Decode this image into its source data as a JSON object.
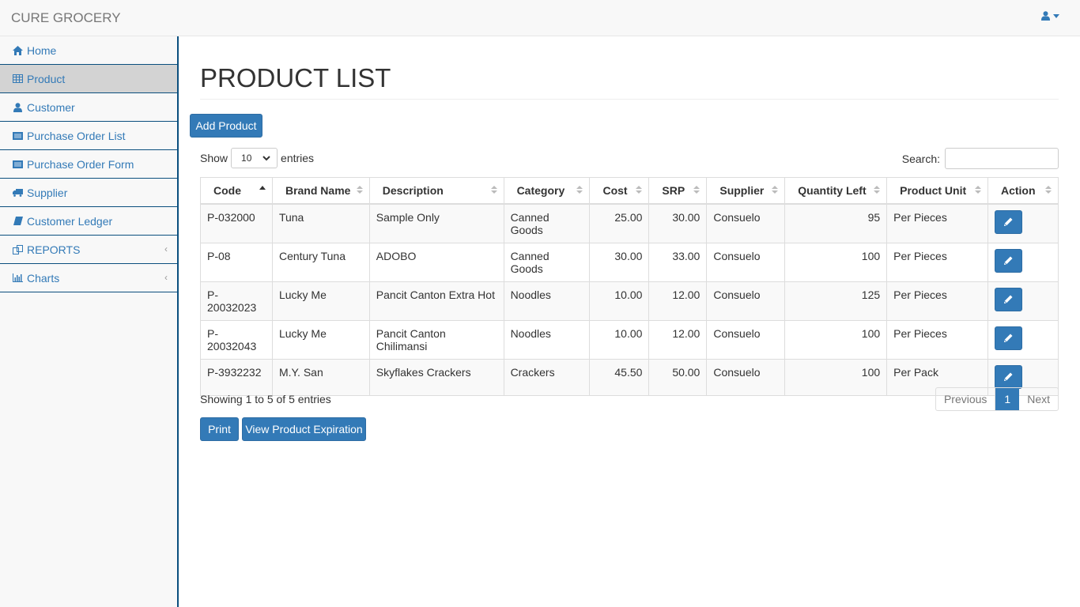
{
  "app": {
    "brand": "CURE GROCERY"
  },
  "colors": {
    "primary": "#337ab7",
    "sidebar_border": "#0b4f7e",
    "active_bg": "#d3d3d3"
  },
  "sidebar": {
    "items": [
      {
        "label": "Home",
        "icon": "home-icon"
      },
      {
        "label": "Product",
        "icon": "table-icon",
        "active": true
      },
      {
        "label": "Customer",
        "icon": "user-icon"
      },
      {
        "label": "Purchase Order List",
        "icon": "list-alt-icon"
      },
      {
        "label": "Purchase Order Form",
        "icon": "list-alt-icon"
      },
      {
        "label": "Supplier",
        "icon": "truck-icon"
      },
      {
        "label": "Customer Ledger",
        "icon": "book-icon"
      },
      {
        "label": "REPORTS",
        "icon": "copy-icon",
        "caret": "‹"
      },
      {
        "label": "Charts",
        "icon": "bar-chart-icon",
        "caret": "‹"
      }
    ]
  },
  "page": {
    "title": "PRODUCT LIST",
    "add_button": "Add Product",
    "show_label": "Show",
    "entries_label": "entries",
    "page_length": "10",
    "search_label": "Search:",
    "search_value": "",
    "info": "Showing 1 to 5 of 5 entries",
    "pager": {
      "previous": "Previous",
      "current": "1",
      "next": "Next"
    },
    "print_button": "Print",
    "expiration_button": "View Product Expiration"
  },
  "table": {
    "columns": [
      "Code",
      "Brand Name",
      "Description",
      "Category",
      "Cost",
      "SRP",
      "Supplier",
      "Quantity Left",
      "Product Unit",
      "Action"
    ],
    "sorted_column": "Code",
    "sort_direction": "asc",
    "rows": [
      [
        "P-032000",
        "Tuna",
        "Sample Only",
        "Canned Goods",
        "25.00",
        "30.00",
        "Consuelo",
        "95",
        "Per Pieces"
      ],
      [
        "P-08",
        "Century Tuna",
        "ADOBO",
        "Canned Goods",
        "30.00",
        "33.00",
        "Consuelo",
        "100",
        "Per Pieces"
      ],
      [
        "P-20032023",
        "Lucky Me",
        "Pancit Canton Extra Hot",
        "Noodles",
        "10.00",
        "12.00",
        "Consuelo",
        "125",
        "Per Pieces"
      ],
      [
        "P-20032043",
        "Lucky Me",
        "Pancit Canton Chilimansi",
        "Noodles",
        "10.00",
        "12.00",
        "Consuelo",
        "100",
        "Per Pieces"
      ],
      [
        "P-3932232",
        "M.Y. San",
        "Skyflakes Crackers",
        "Crackers",
        "45.50",
        "50.00",
        "Consuelo",
        "100",
        "Per Pack"
      ]
    ],
    "action_icon": "pencil-icon"
  }
}
